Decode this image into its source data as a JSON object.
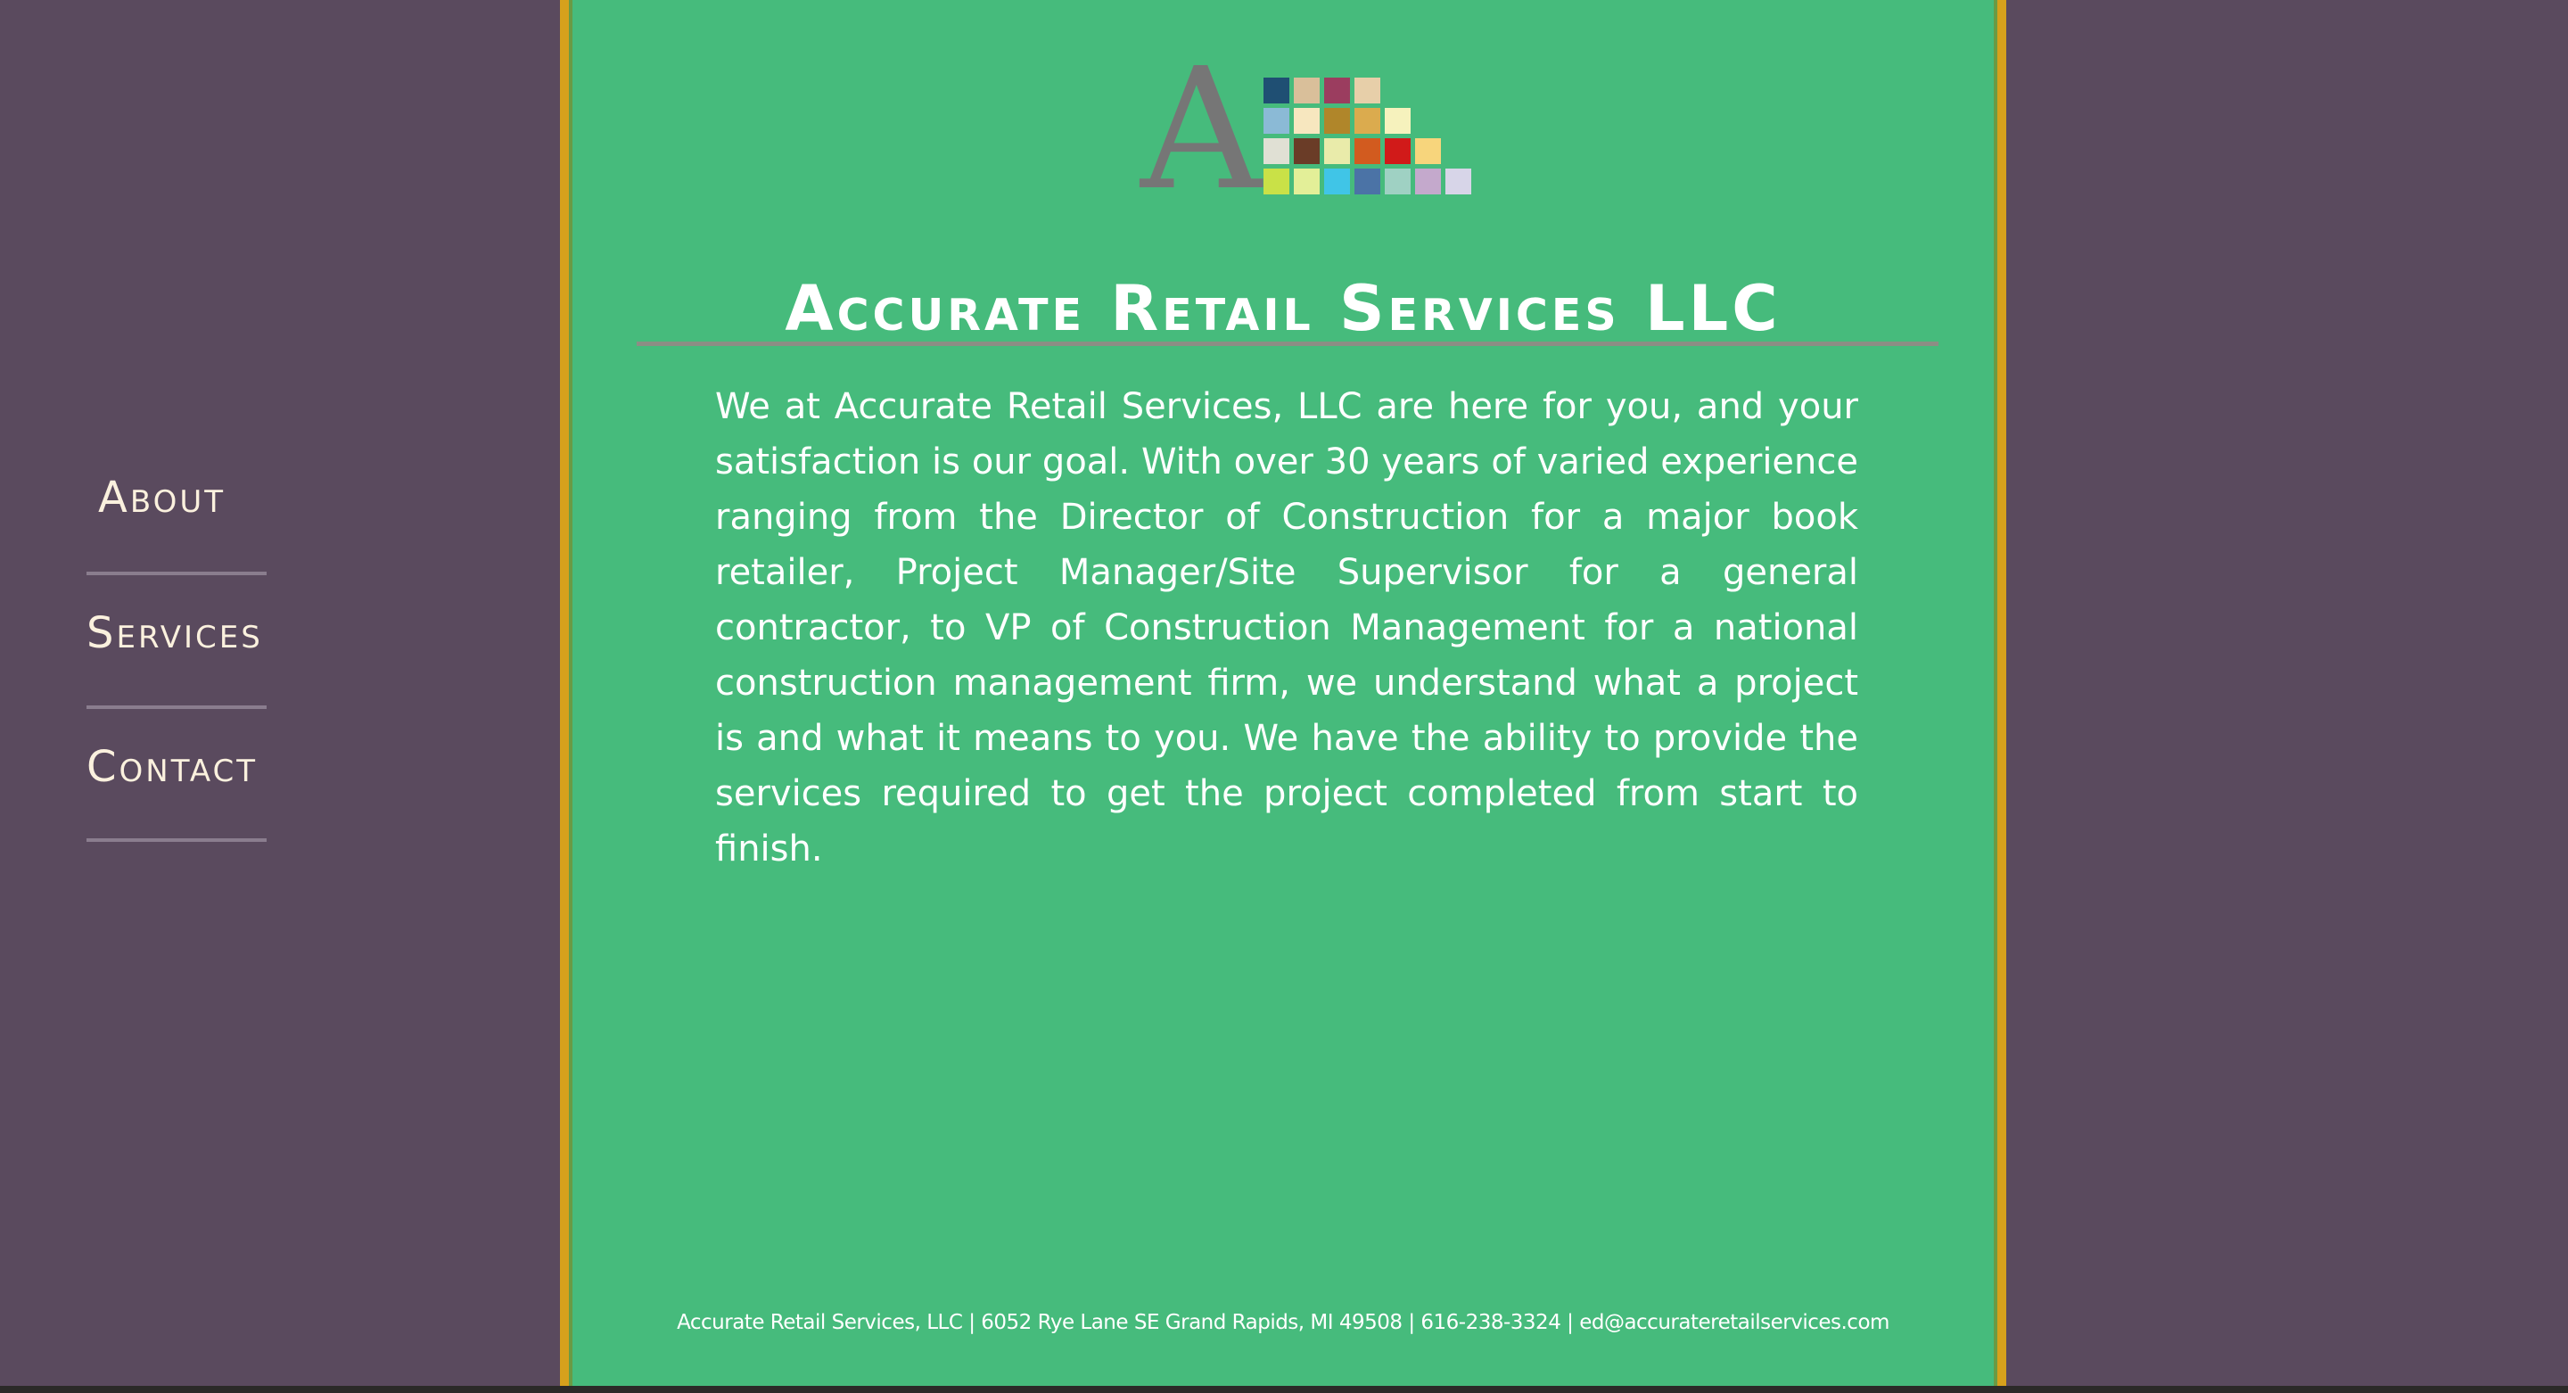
{
  "nav": {
    "items": [
      {
        "label": "About"
      },
      {
        "label": "Services"
      },
      {
        "label": "Contact"
      }
    ]
  },
  "logo": {
    "letter": "A",
    "tile_colors": [
      [
        "#1f4f73",
        "#d9bf9a",
        "#9b3d5f",
        "#e7cfa9"
      ],
      [
        "#8bbad6",
        "#f7e7bf",
        "#b0862a",
        "#dbab4e",
        "#f6f2bd"
      ],
      [
        "#e0e0d4",
        "#6a3c27",
        "#e9ebaa",
        "#d25b1f",
        "#d11a19",
        "#f7d57c"
      ],
      [
        "#c9e147",
        "#e3ef98",
        "#40c5e7",
        "#4b73a6",
        "#9fd1c3",
        "#c4a9cc",
        "#d7d5e8"
      ]
    ]
  },
  "site_title": "Accurate Retail Services LLC",
  "intro_text": "We at Accurate Retail Services, LLC are here for you, and your satisfaction is our goal. With over 30 years of varied experience ranging from the Director of Construction for a major book retailer, Project Manager/Site Supervisor for a general contractor, to VP of Construction Management for a national construction management firm, we understand what a project is and what it means to you. We have the ability to provide the services required to get the project completed from start to finish.",
  "footer_text": "Accurate Retail Services, LLC | 6052 Rye Lane SE Grand Rapids, MI 49508 | 616-238-3324 | ed@accurateretailservices.com",
  "colors": {
    "background": "#5a4a5e",
    "panel": "#46bb7c",
    "panel_border": "#d6a11c",
    "nav_text": "#fbf1de"
  }
}
